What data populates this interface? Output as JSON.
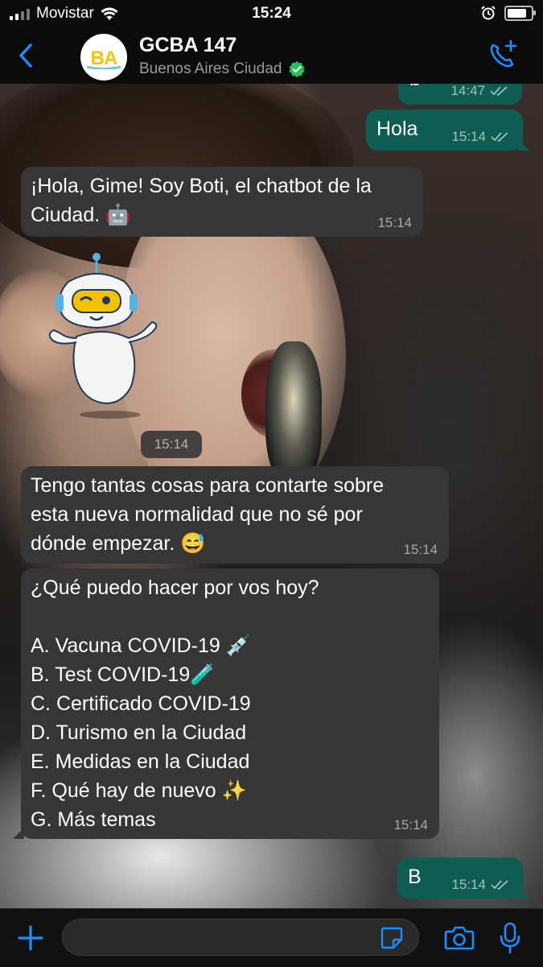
{
  "status_bar": {
    "carrier": "Movistar",
    "time": "15:24",
    "battery_level": 0.9
  },
  "header": {
    "avatar_text": "BA",
    "contact_name": "GCBA 147",
    "contact_subtitle": "Buenos Aires Ciudad"
  },
  "colors": {
    "accent": "#1f8bff",
    "outgoing_bubble": "#0e5c52",
    "incoming_bubble": "#363636",
    "verified": "#25c45a"
  },
  "messages": [
    {
      "direction": "out",
      "text": "b",
      "time": "14:47",
      "status": "read"
    },
    {
      "direction": "out",
      "text": "Hola",
      "time": "15:14",
      "status": "read"
    },
    {
      "direction": "in",
      "text": "¡Hola, Gime! Soy Boti, el chatbot de la\nCiudad. 🤖",
      "time": "15:14"
    },
    {
      "direction": "in",
      "type": "sticker",
      "sticker": "robot-sticker",
      "time": "15:14"
    },
    {
      "direction": "in",
      "text": "Tengo tantas cosas para contarte sobre\nesta nueva normalidad que no sé por\ndónde empezar. 😅",
      "time": "15:14"
    },
    {
      "direction": "in",
      "text": "¿Qué puedo hacer por vos hoy?\n\nA. Vacuna COVID-19 💉\nB. Test COVID-19🧪\nC. Certificado COVID-19\nD. Turismo en la Ciudad\nE. Medidas en la Ciudad\nF. Qué hay de nuevo ✨\nG. Más temas",
      "time": "15:14"
    },
    {
      "direction": "out",
      "text": "B",
      "time": "15:14",
      "status": "read"
    }
  ],
  "input_bar": {
    "placeholder": "",
    "icons": [
      "plus-icon",
      "sticker-icon",
      "camera-icon",
      "microphone-icon"
    ]
  }
}
